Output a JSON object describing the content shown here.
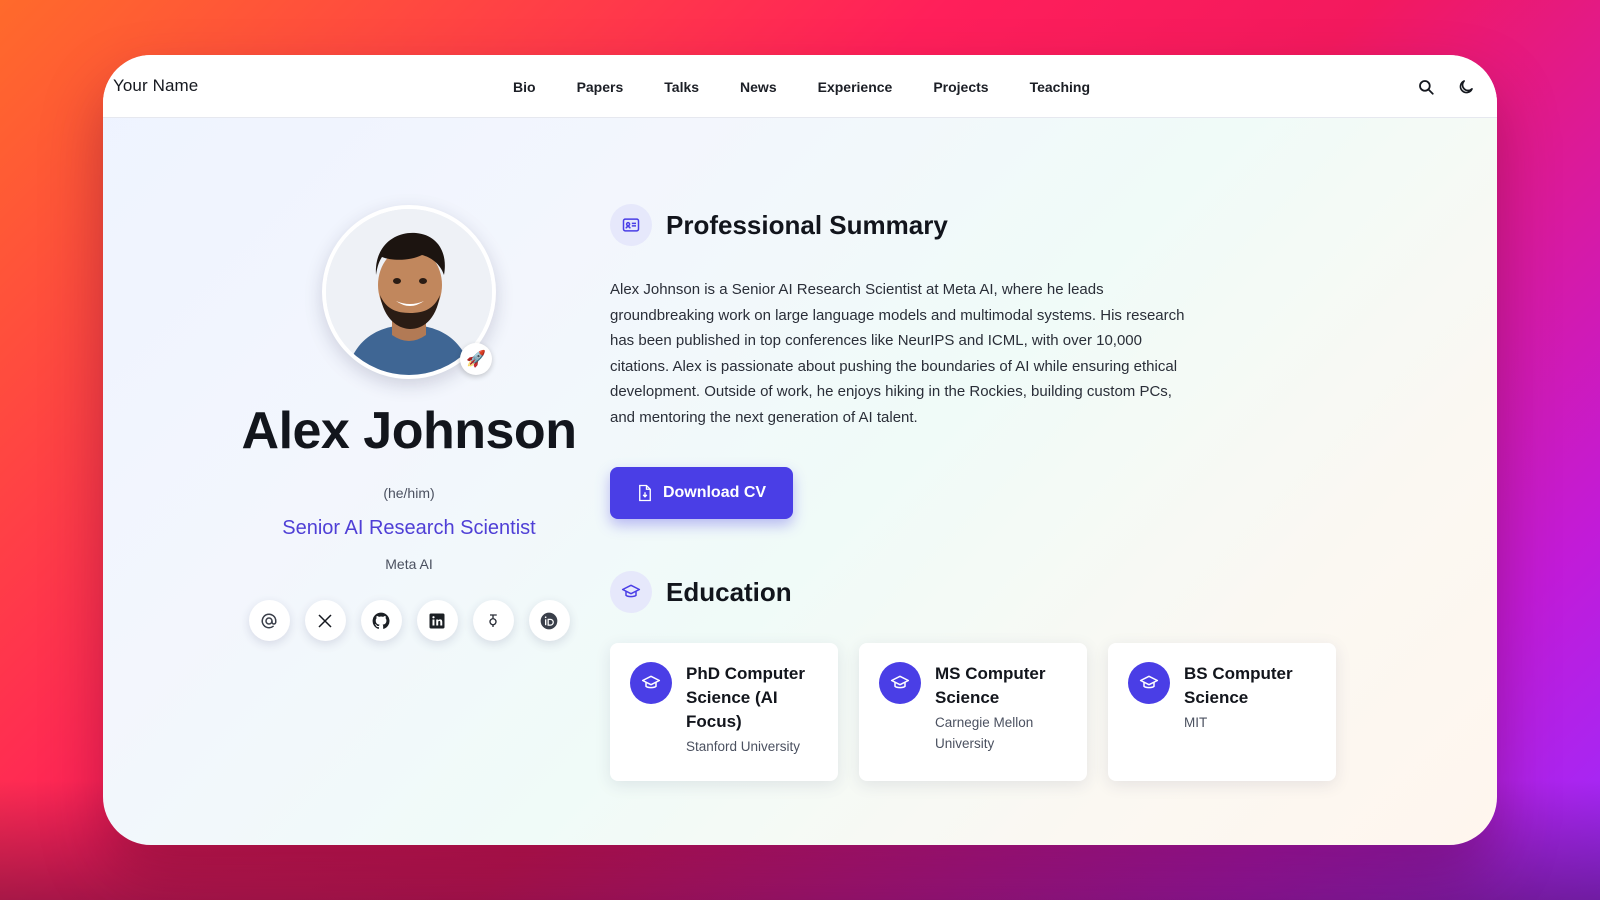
{
  "nav": {
    "brand": "Your Name",
    "links": [
      "Bio",
      "Papers",
      "Talks",
      "News",
      "Experience",
      "Projects",
      "Teaching"
    ],
    "actions": [
      "search-icon",
      "moon-icon"
    ]
  },
  "profile": {
    "name": "Alex Johnson",
    "pronouns": "(he/him)",
    "role": "Senior AI Research Scientist",
    "organization": "Meta AI",
    "status_badge": "🚀",
    "socials": [
      "email-icon",
      "x-icon",
      "github-icon",
      "linkedin-icon",
      "google-scholar-icon",
      "orcid-icon"
    ]
  },
  "summary": {
    "title": "Professional Summary",
    "body": "Alex Johnson is a Senior AI Research Scientist at Meta AI, where he leads groundbreaking work on large language models and multimodal systems. His research has been published in top conferences like NeurIPS and ICML, with over 10,000 citations. Alex is passionate about pushing the boundaries of AI while ensuring ethical development. Outside of work, he enjoys hiking in the Rockies, building custom PCs, and mentoring the next generation of AI talent.",
    "cv_button": "Download CV"
  },
  "education": {
    "title": "Education",
    "items": [
      {
        "degree": "PhD Computer Science (AI Focus)",
        "school": "Stanford University"
      },
      {
        "degree": "MS Computer Science",
        "school": "Carnegie Mellon University"
      },
      {
        "degree": "BS Computer Science",
        "school": "MIT"
      }
    ]
  },
  "colors": {
    "accent": "#4a3ee6",
    "role_text": "#4f3fd6"
  }
}
